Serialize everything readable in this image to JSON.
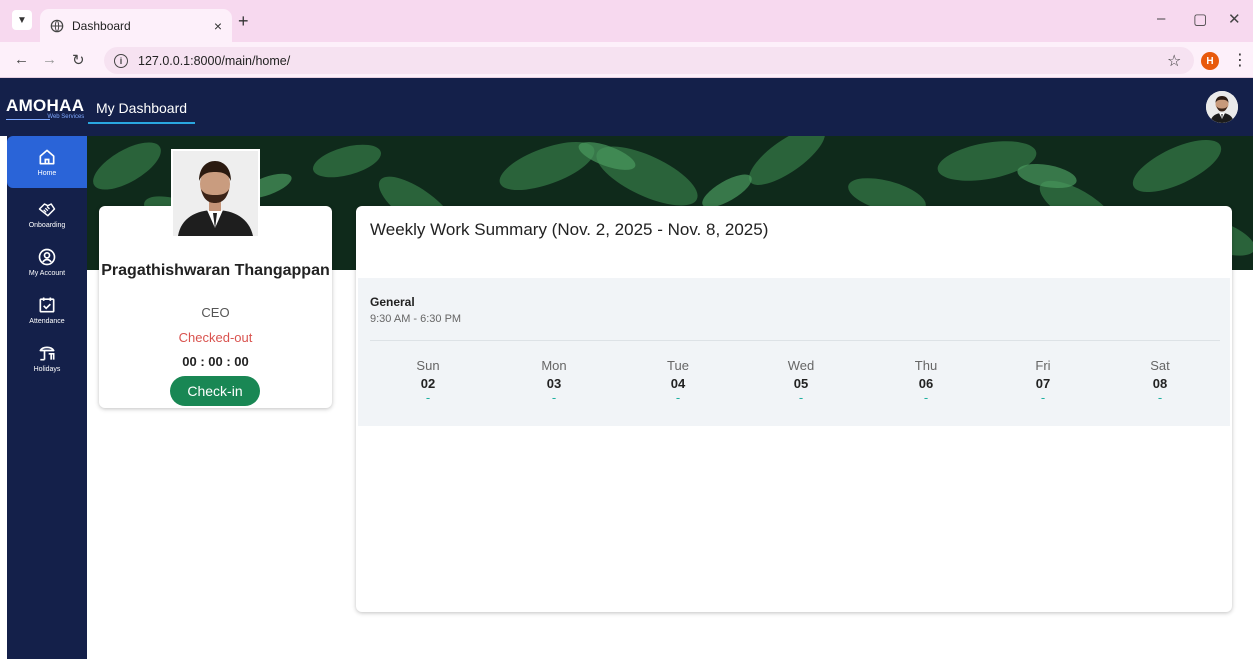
{
  "browser": {
    "tab_title": "Dashboard",
    "tab_close": "×",
    "new_tab": "+",
    "url": "127.0.0.1:8000/main/home/",
    "profile_initial": "H",
    "window_controls": [
      "–",
      "▢",
      "✕"
    ]
  },
  "header": {
    "brand_name": "AMOHAA",
    "brand_sub": "Web Services",
    "menu_item": "My Dashboard"
  },
  "sidebar": {
    "items": [
      {
        "label": "Home",
        "icon": "home-icon",
        "active": true
      },
      {
        "label": "Onboarding",
        "icon": "handshake-icon",
        "active": false
      },
      {
        "label": "My Account",
        "icon": "account-icon",
        "active": false
      },
      {
        "label": "Attendance",
        "icon": "calendar-check-icon",
        "active": false
      },
      {
        "label": "Holidays",
        "icon": "beach-icon",
        "active": false
      }
    ]
  },
  "profile": {
    "name": "Pragathishwaran Thangappan",
    "role": "CEO",
    "status": "Checked-out",
    "timer": "00 : 00 : 00",
    "checkin_label": "Check-in"
  },
  "summary": {
    "title": "Weekly Work Summary (Nov. 2, 2025 - Nov. 8, 2025)",
    "shift_name": "General",
    "shift_time": "9:30 AM - 6:30 PM",
    "days": [
      {
        "name": "Sun",
        "date": "02",
        "value": "-"
      },
      {
        "name": "Mon",
        "date": "03",
        "value": "-"
      },
      {
        "name": "Tue",
        "date": "04",
        "value": "-"
      },
      {
        "name": "Wed",
        "date": "05",
        "value": "-"
      },
      {
        "name": "Thu",
        "date": "06",
        "value": "-"
      },
      {
        "name": "Fri",
        "date": "07",
        "value": "-"
      },
      {
        "name": "Sat",
        "date": "08",
        "value": "-"
      }
    ]
  },
  "colors": {
    "navy": "#14204a",
    "active_blue": "#2a64d8",
    "checkin_green": "#198754",
    "status_red": "#d9534f"
  }
}
